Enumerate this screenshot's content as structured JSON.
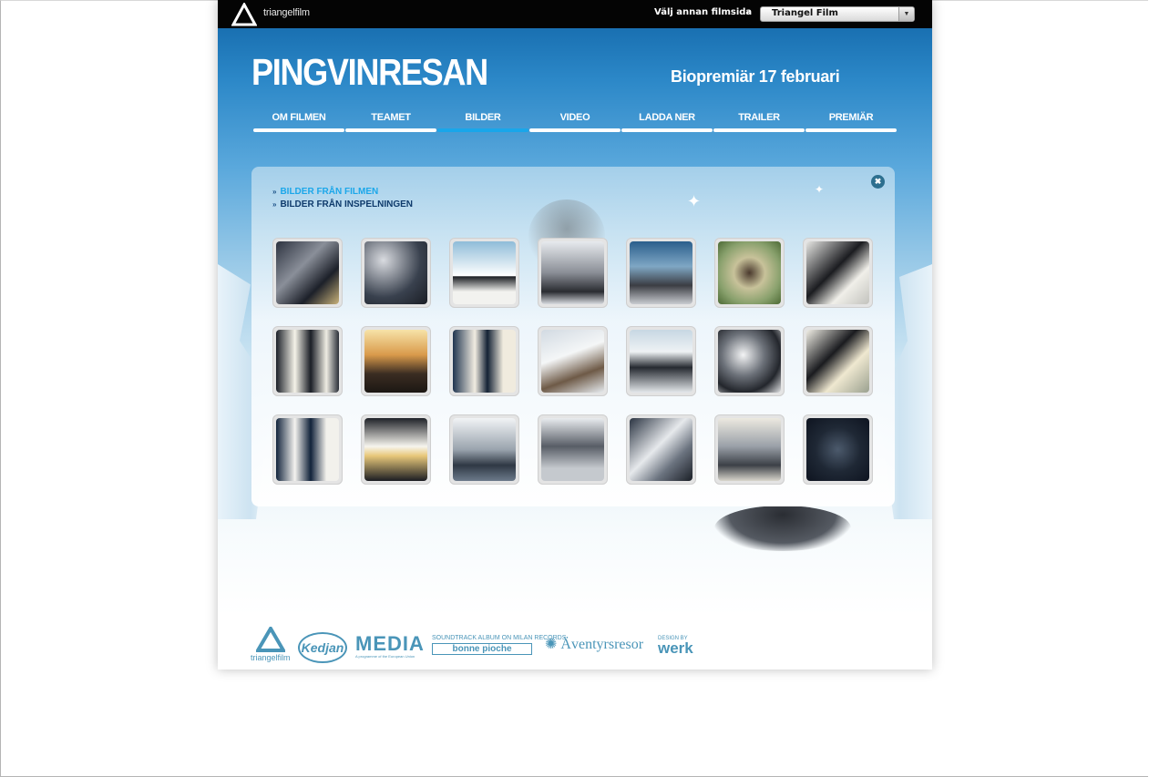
{
  "topbar": {
    "logo_text": "triangelfilm",
    "select_label": "Välj annan filmsida",
    "select_arrows": "»",
    "select_value": "Triangel Film"
  },
  "header": {
    "title": "PINGVINRESAN",
    "premiere": "Biopremiär 17 februari"
  },
  "nav": {
    "items": [
      {
        "label": "OM FILMEN",
        "active": false
      },
      {
        "label": "TEAMET",
        "active": false
      },
      {
        "label": "BILDER",
        "active": true
      },
      {
        "label": "VIDEO",
        "active": false
      },
      {
        "label": "LADDA NER",
        "active": false
      },
      {
        "label": "TRAILER",
        "active": false
      },
      {
        "label": "PREMIÄR",
        "active": false
      }
    ],
    "active_color": "#19a6ea"
  },
  "gallery": {
    "close_glyph": "✖",
    "sublink_arrow": "»",
    "sublinks": [
      {
        "label": "BILDER FRÅN FILMEN",
        "active": true
      },
      {
        "label": "BILDER FRÅN INSPELNINGEN",
        "active": false
      }
    ],
    "thumb_count": 21
  },
  "footer": {
    "logos": {
      "triangelfilm": "triangelfilm",
      "kedjan": "Kedjan",
      "media": "MEDIA",
      "media_sub": "A programme of the European Union",
      "soundtrack": "SOUNDTRACK ALBUM ON MILAN RECORDS",
      "bonne": "bonne pioche",
      "aventyr": "Äventyrsresor",
      "design_by": "DESIGN BY",
      "werk": "werk"
    }
  }
}
